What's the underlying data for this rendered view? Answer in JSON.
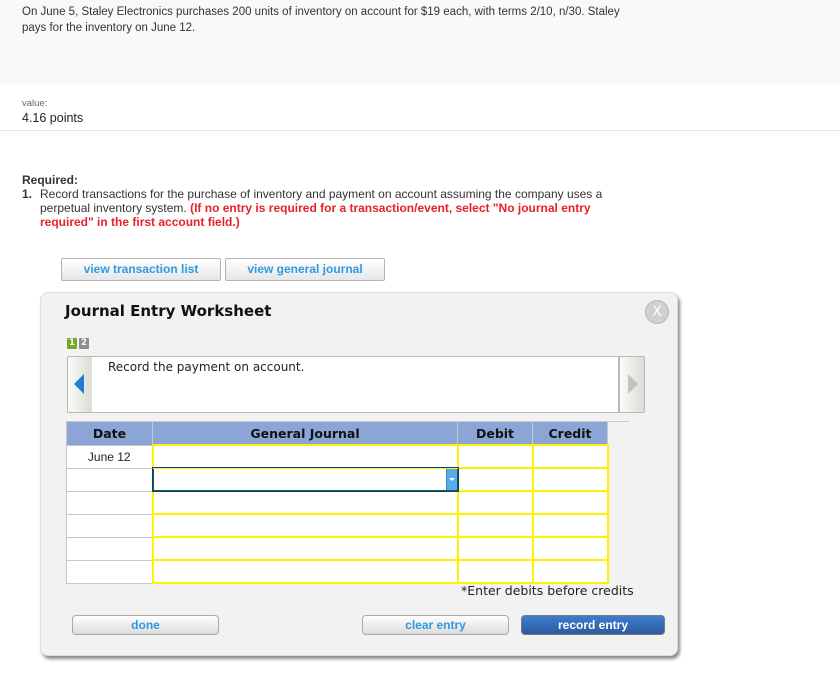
{
  "question": {
    "text": "On June 5, Staley Electronics purchases 200 units of inventory on account for $19 each, with terms 2/10, n/30. Staley pays for the inventory on June 12."
  },
  "value": {
    "label": "value:",
    "points": "4.16 points"
  },
  "required": {
    "heading": "Required:",
    "items": [
      {
        "number": "1.",
        "text": "Record transactions for the purchase of inventory and payment on account assuming the company uses a perpetual inventory system.",
        "instruction": "(If no entry is required for a transaction/event, select \"No journal entry required\" in the first account field.)"
      }
    ]
  },
  "view_buttons": {
    "transaction_list": "view transaction list",
    "general_journal": "view general journal"
  },
  "worksheet": {
    "title": "Journal Entry Worksheet",
    "close_label": "X",
    "steps": [
      {
        "label": "1",
        "active": true
      },
      {
        "label": "2",
        "active": false
      }
    ],
    "description": "Record the payment on account.",
    "table": {
      "headers": [
        "Date",
        "General Journal",
        "Debit",
        "Credit"
      ],
      "rows": [
        {
          "date": "June 12",
          "account": "",
          "debit": "",
          "credit": ""
        },
        {
          "date": "",
          "account": "",
          "debit": "",
          "credit": ""
        },
        {
          "date": "",
          "account": "",
          "debit": "",
          "credit": ""
        },
        {
          "date": "",
          "account": "",
          "debit": "",
          "credit": ""
        },
        {
          "date": "",
          "account": "",
          "debit": "",
          "credit": ""
        },
        {
          "date": "",
          "account": "",
          "debit": "",
          "credit": ""
        }
      ]
    },
    "hint": "*Enter debits before credits",
    "buttons": {
      "done": "done",
      "clear": "clear entry",
      "record": "record entry"
    }
  }
}
